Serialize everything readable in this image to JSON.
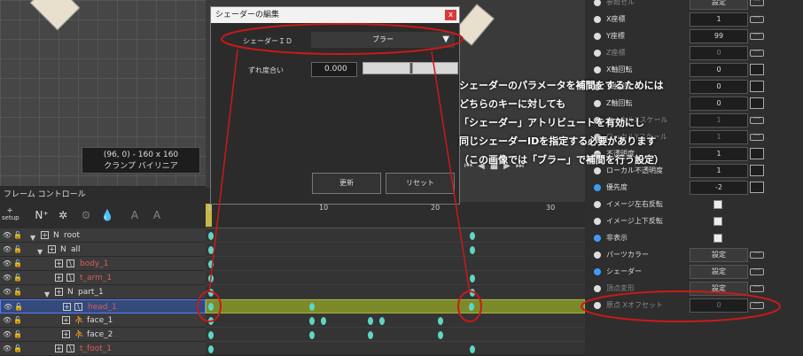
{
  "viewport": {
    "coords": "(96, 0) - 160 x 160",
    "mode": "クランプ バイリニア"
  },
  "frame_control": {
    "title": "フレーム コントロール",
    "setup_label": "setup"
  },
  "ruler": {
    "ticks": [
      "1",
      "10",
      "20",
      "30"
    ]
  },
  "layers": [
    {
      "name": "root",
      "type": "N"
    },
    {
      "name": "all",
      "type": "N"
    },
    {
      "name": "body_1",
      "type": "img"
    },
    {
      "name": "t_arm_1",
      "type": "img"
    },
    {
      "name": "l_arm_1",
      "type": "img"
    },
    {
      "name": "part_1",
      "type": "N"
    },
    {
      "name": "head_1",
      "type": "img"
    },
    {
      "name": "face_1",
      "type": "bone"
    },
    {
      "name": "face_2",
      "type": "bone"
    },
    {
      "name": "t_foot_1",
      "type": "img"
    }
  ],
  "dialog": {
    "title": "シェーダーの編集",
    "close": "x",
    "shader_id_label": "シェーダーＩＤ",
    "shader_id_value": "ブラー",
    "degree_label": "ずれ度合い",
    "degree_value": "0.000",
    "update_button": "更新",
    "reset_button": "リセット",
    "slider_value": 0.5
  },
  "properties": [
    {
      "label": "参照セル",
      "value": "設定",
      "kind": "button",
      "dim": true
    },
    {
      "label": "X座標",
      "value": "1",
      "kind": "value"
    },
    {
      "label": "Y座標",
      "value": "99",
      "kind": "value"
    },
    {
      "label": "Z座標",
      "value": "0",
      "kind": "value",
      "dim": true
    },
    {
      "label": "X軸回転",
      "value": "0",
      "kind": "value"
    },
    {
      "label": "Y軸回転",
      "value": "0",
      "kind": "value"
    },
    {
      "label": "Z軸回転",
      "value": "0",
      "kind": "value"
    },
    {
      "label": "ローカルXスケール",
      "value": "1",
      "kind": "value",
      "dim": true
    },
    {
      "label": "ローカルYスケール",
      "value": "1",
      "kind": "value",
      "dim": true
    },
    {
      "label": "不透明度",
      "value": "1",
      "kind": "value"
    },
    {
      "label": "ローカル不透明度",
      "value": "1",
      "kind": "value"
    },
    {
      "label": "優先度",
      "value": "-2",
      "kind": "value",
      "blue": true
    },
    {
      "label": "イメージ左右反転",
      "kind": "check"
    },
    {
      "label": "イメージ上下反転",
      "kind": "check"
    },
    {
      "label": "非表示",
      "kind": "check",
      "blue": true
    },
    {
      "label": "パーツカラー",
      "value": "設定",
      "kind": "button"
    },
    {
      "label": "シェーダー",
      "value": "設定",
      "kind": "button",
      "blue": true
    },
    {
      "label": "頂点変形",
      "value": "設定",
      "kind": "button",
      "dim": true
    },
    {
      "label": "原点 Xオフセット",
      "value": "0",
      "kind": "value",
      "dim": true
    }
  ],
  "annotation": [
    "シェーダーのパラメータを補間をするためには",
    "どちらのキーに対しても",
    "「シェーダー」アトリビュートを有効にし",
    "同じシェーダーIDを指定する必要があります",
    "（この画像では「ブラー」で補間を行う設定）"
  ],
  "colors": {
    "highlight": "#c91a1a",
    "keyframe": "#5fd6c4",
    "accent": "#3d9bf5"
  }
}
